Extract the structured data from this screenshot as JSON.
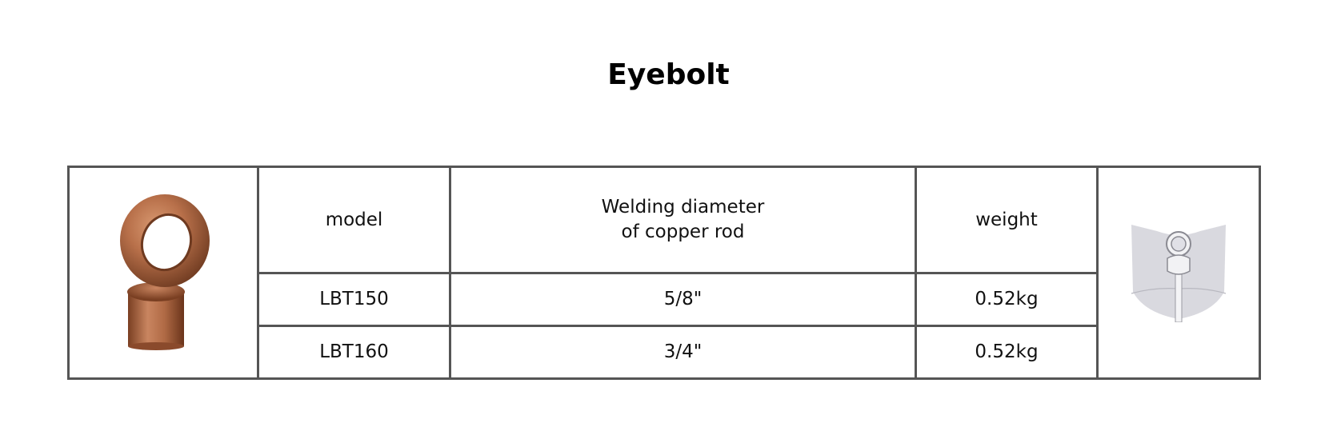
{
  "title": "Eyebolt",
  "table": {
    "headers": {
      "model": "model",
      "diameter": "Welding diameter\nof copper rod",
      "weight": "weight"
    },
    "rows": [
      {
        "model": "LBT150",
        "diameter": "5/8\"",
        "weight": "0.52kg"
      },
      {
        "model": "LBT160",
        "diameter": "3/4\"",
        "weight": "0.52kg"
      }
    ]
  },
  "images": {
    "product": "copper-eyebolt-photo",
    "diagram": "eyebolt-installation-diagram"
  },
  "colors": {
    "copper": "#b8704a",
    "border": "#555555",
    "diagram_gray": "#d9d9df"
  }
}
